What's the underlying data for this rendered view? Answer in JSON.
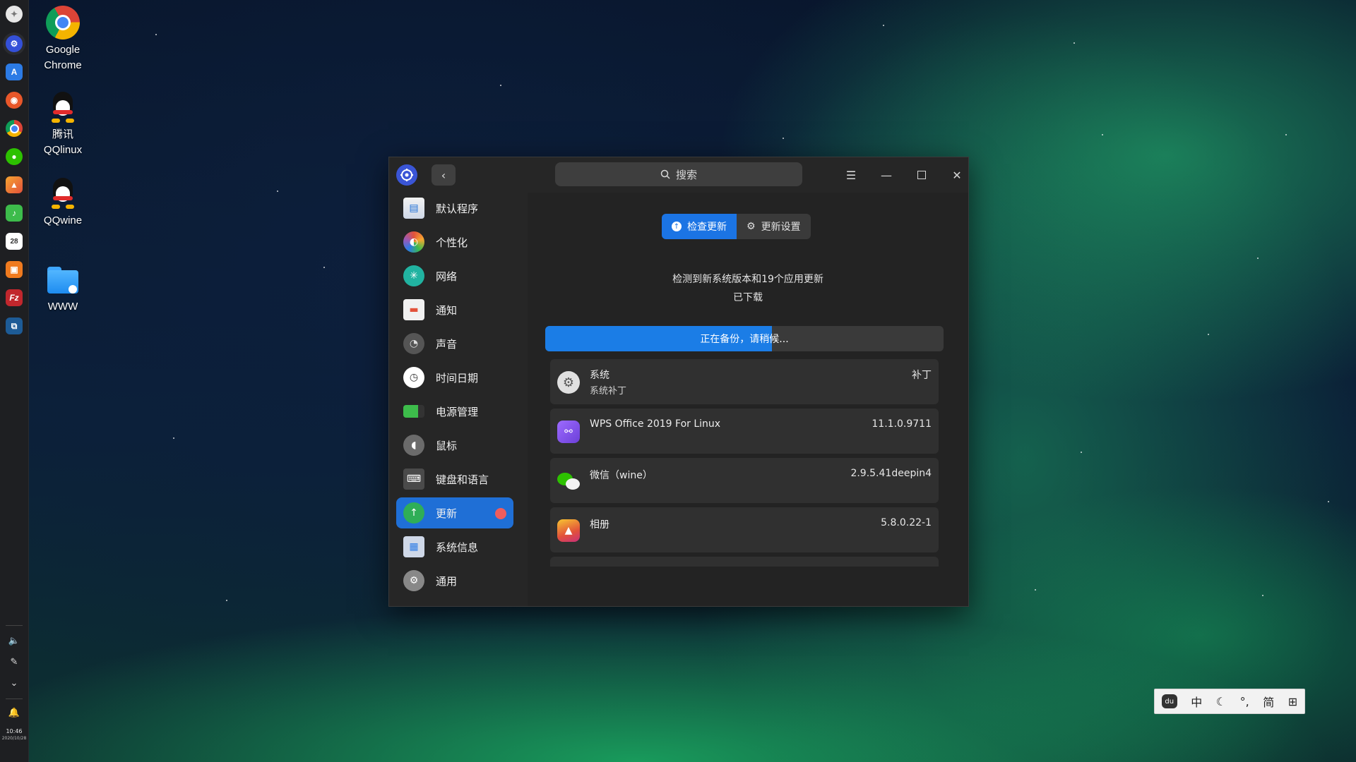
{
  "desktop": {
    "icons": [
      {
        "label": "Google\nChrome",
        "icon": "chrome-icon"
      },
      {
        "label": "腾讯\nQQlinux",
        "icon": "qq-icon"
      },
      {
        "label": "QQwine",
        "icon": "qq-icon"
      },
      {
        "label": "WWW",
        "icon": "folder-icon"
      }
    ]
  },
  "dock": {
    "clock_time": "10:46",
    "clock_date": "2020/10/28",
    "calendar_day": "28"
  },
  "window": {
    "search_placeholder": "搜索",
    "sidebar": {
      "items": [
        {
          "label": "默认程序",
          "icon": "default-apps-icon"
        },
        {
          "label": "个性化",
          "icon": "personalization-icon"
        },
        {
          "label": "网络",
          "icon": "network-icon"
        },
        {
          "label": "通知",
          "icon": "notification-icon"
        },
        {
          "label": "声音",
          "icon": "sound-icon"
        },
        {
          "label": "时间日期",
          "icon": "clock-icon"
        },
        {
          "label": "电源管理",
          "icon": "battery-icon"
        },
        {
          "label": "鼠标",
          "icon": "mouse-icon"
        },
        {
          "label": "键盘和语言",
          "icon": "keyboard-icon"
        },
        {
          "label": "更新",
          "icon": "update-icon",
          "selected": true
        },
        {
          "label": "系统信息",
          "icon": "system-info-icon"
        },
        {
          "label": "通用",
          "icon": "general-icon"
        }
      ]
    },
    "update": {
      "tabs": [
        {
          "label": "检查更新",
          "active": true
        },
        {
          "label": "更新设置",
          "active": false
        }
      ],
      "status_line1": "检测到新系统版本和19个应用更新",
      "status_line2": "已下载",
      "progress_text": "正在备份，请稍候...",
      "progress_fraction": 0.57,
      "list": [
        {
          "name": "系统",
          "subtitle": "系统补丁",
          "version": "补丁",
          "icon": "system-gear-icon"
        },
        {
          "name": "WPS Office 2019 For Linux",
          "subtitle": "",
          "version": "11.1.0.9711",
          "icon": "wps-icon"
        },
        {
          "name": "微信（wine）",
          "subtitle": "",
          "version": "2.9.5.41deepin4",
          "icon": "wechat-icon"
        },
        {
          "name": "相册",
          "subtitle": "",
          "version": "5.8.0.22-1",
          "icon": "album-icon"
        }
      ]
    }
  },
  "ime": {
    "mode": "中",
    "punct": "°,",
    "script": "简"
  },
  "colors": {
    "accent": "#1b74e4",
    "window_bg": "#262626",
    "badge": "#f05d5d"
  }
}
